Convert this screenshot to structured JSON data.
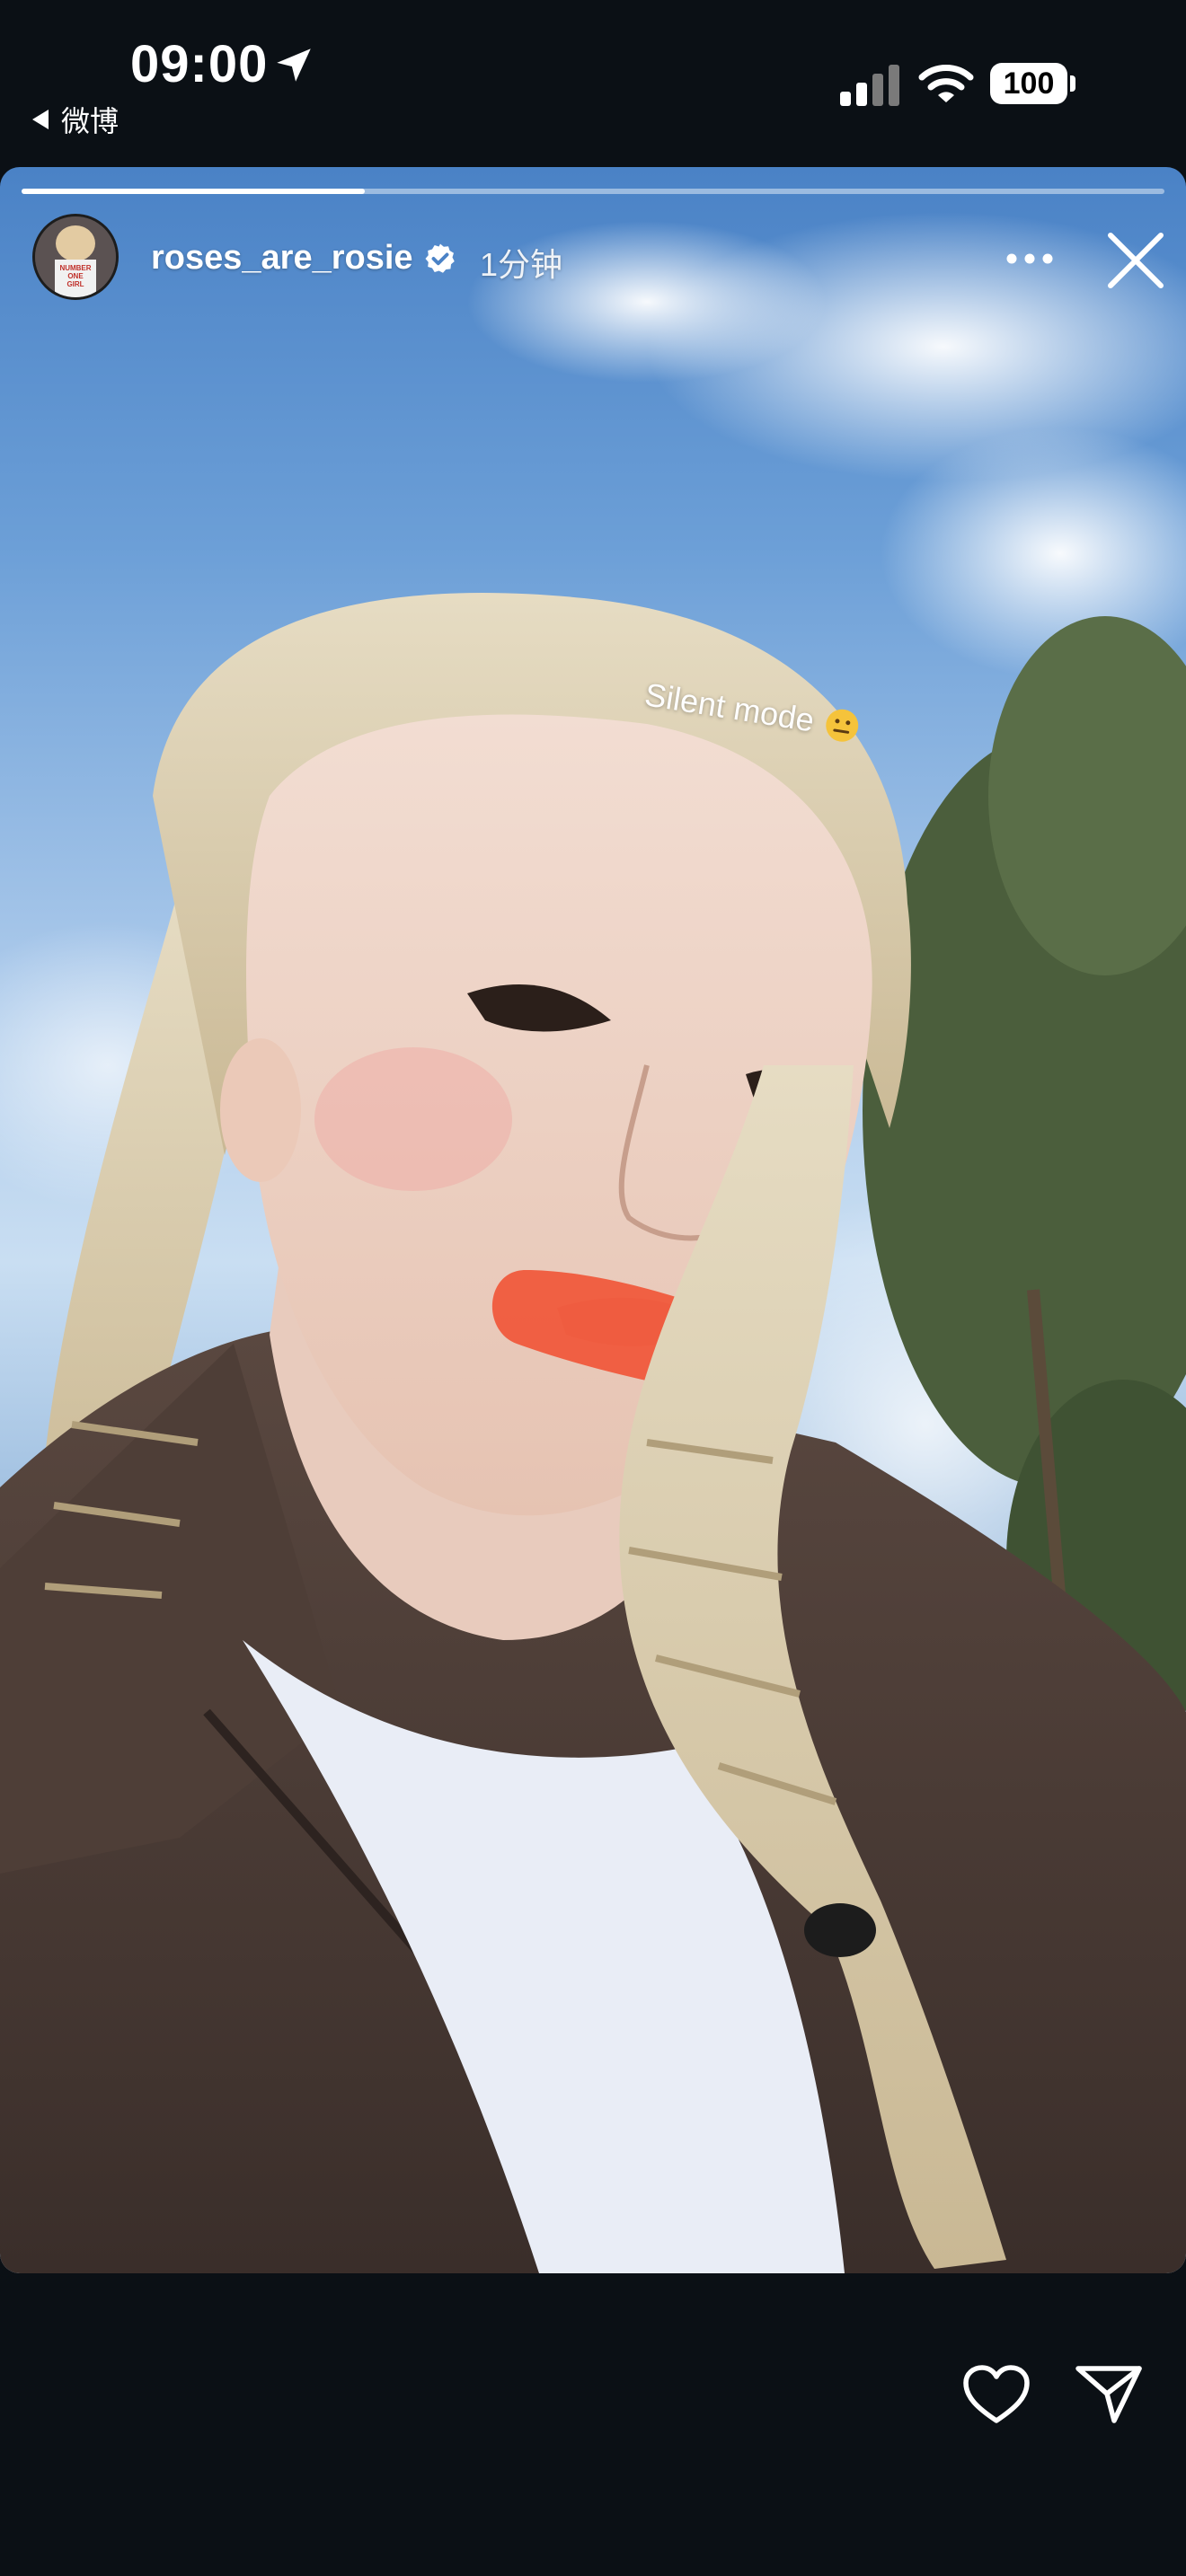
{
  "status_bar": {
    "time": "09:00",
    "back_app_label": "微博",
    "battery_level": "100",
    "icons": [
      "location-arrow-icon",
      "signal-icon",
      "wifi-icon",
      "battery-icon"
    ]
  },
  "story": {
    "username": "roses_are_rosie",
    "verified": true,
    "posted_ago": "1分钟",
    "progress_fraction": 0.3,
    "sticker_text": "Silent mode",
    "sticker_emoji": "zipper-mouth-face-icon",
    "header_icons": [
      "more-options-icon",
      "close-icon"
    ],
    "avatar_text_lines": [
      "NUMBER",
      "ONE",
      "GIRL"
    ]
  },
  "bottom_bar": {
    "icons": [
      "heart-icon",
      "send-icon"
    ]
  },
  "colors": {
    "background": "#0b1015",
    "bandage": "#f05a3c",
    "sky": "#6c9fd7",
    "jacket": "#4a3b35",
    "shirt": "#e9edf6",
    "hair": "#dccdaa"
  }
}
